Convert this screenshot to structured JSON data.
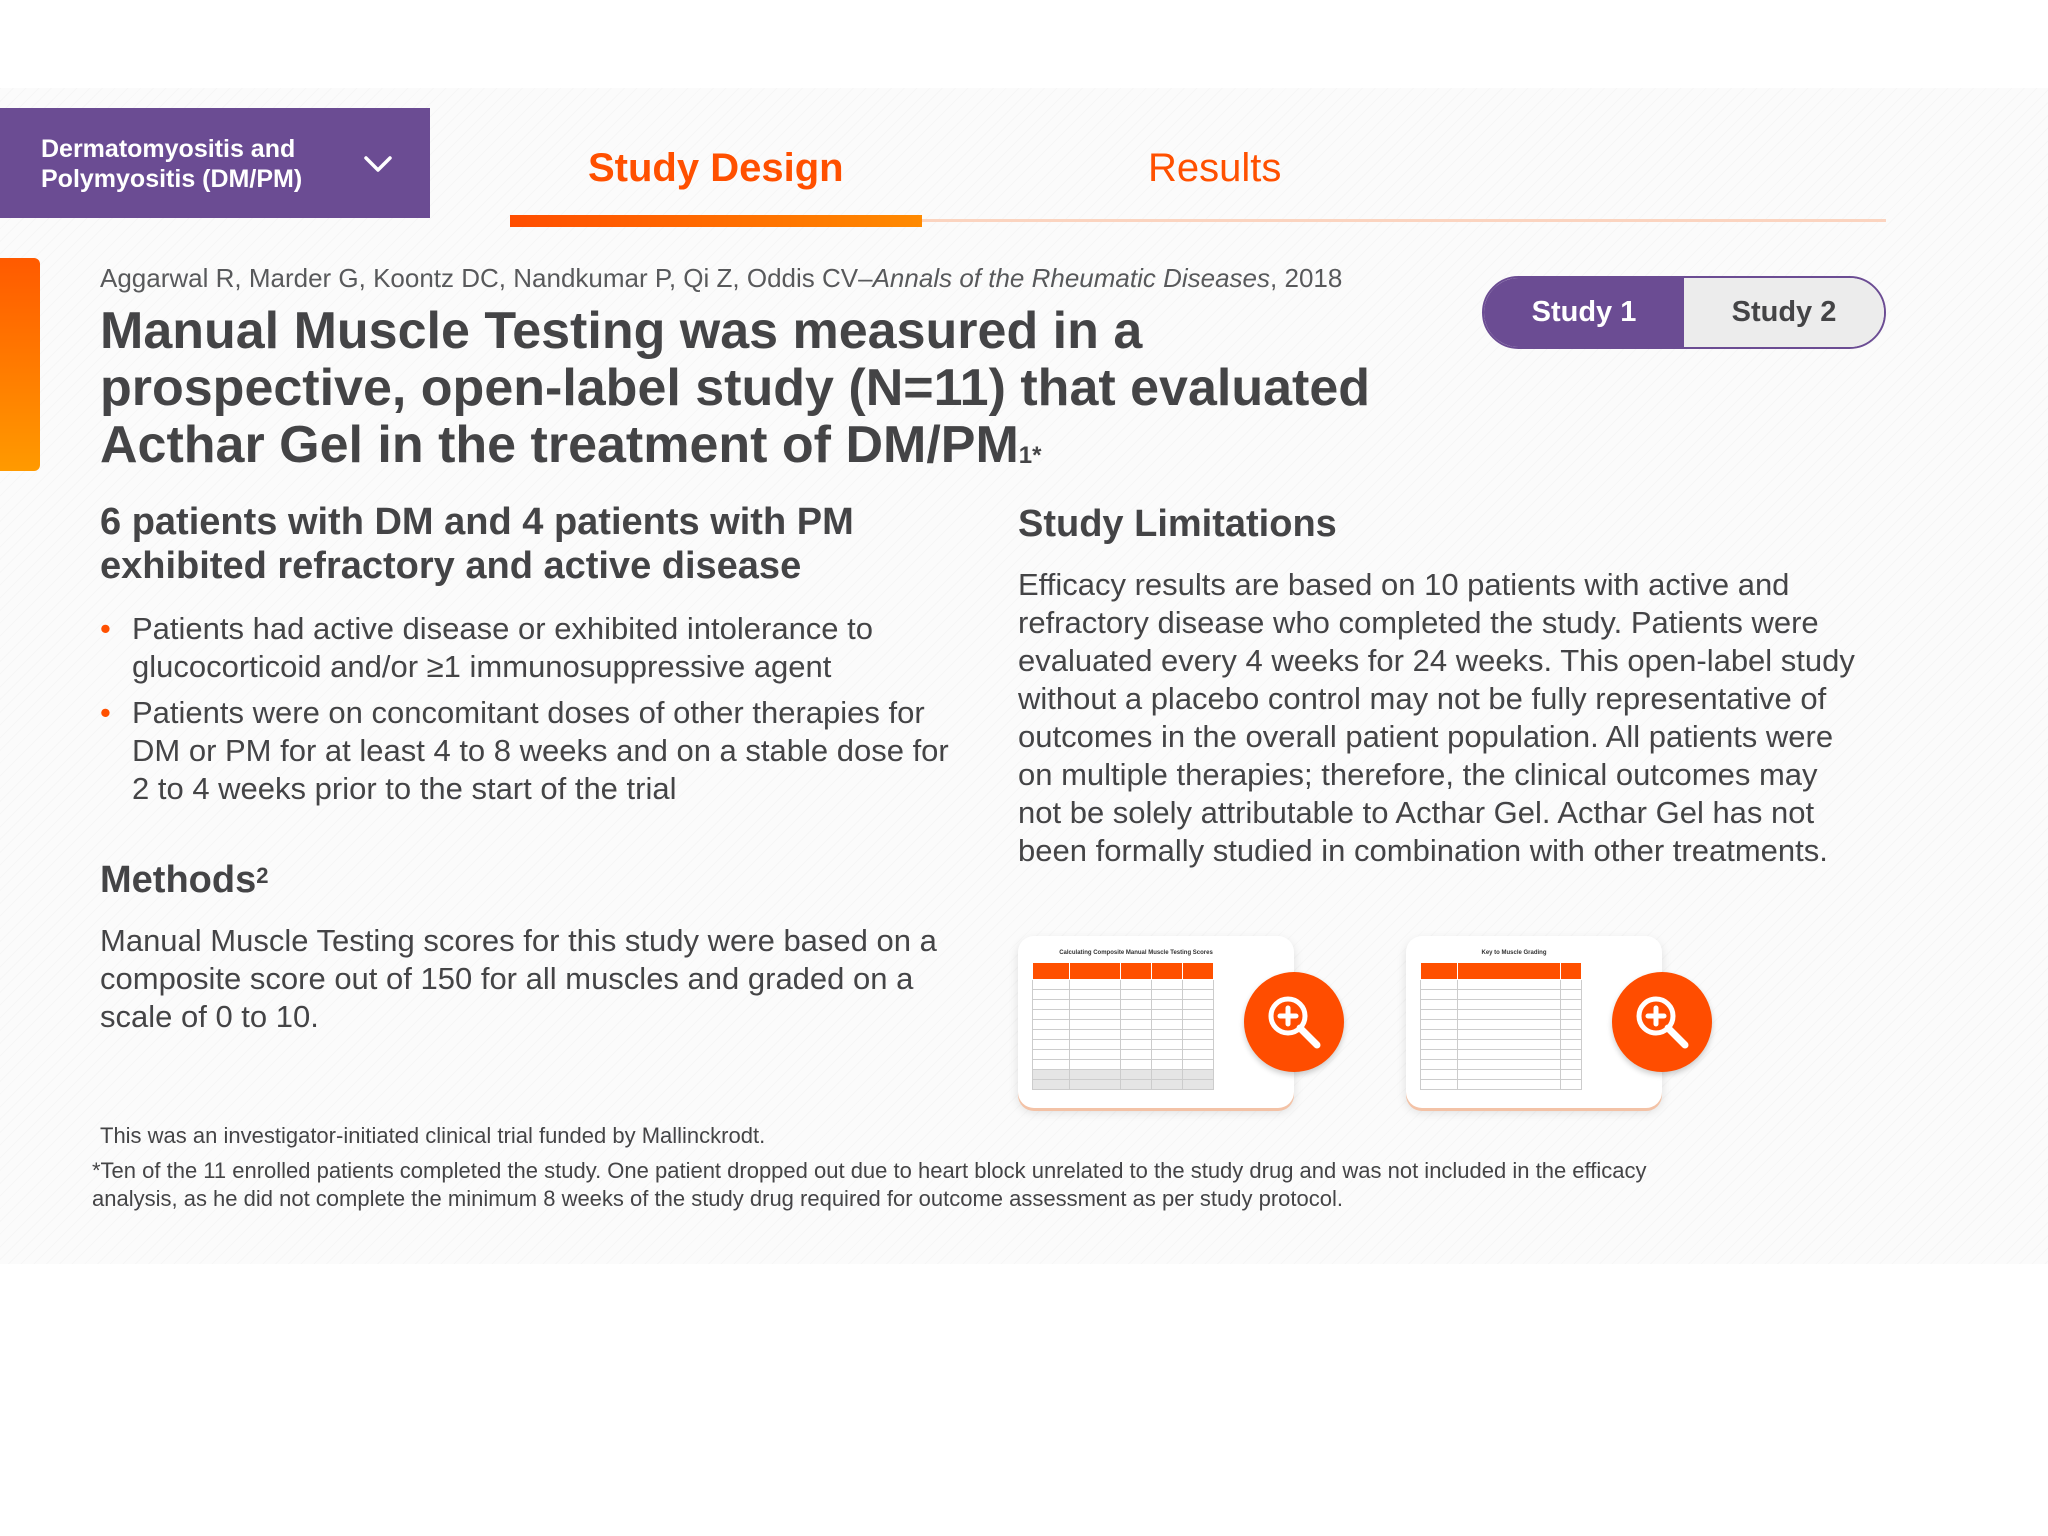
{
  "nav": {
    "dropdown_label": "Dermatomyositis and Polymyositis (DM/PM)",
    "tabs": [
      {
        "label": "Study Design",
        "active": true
      },
      {
        "label": "Results",
        "active": false
      }
    ]
  },
  "study_toggle": [
    {
      "label": "Study 1",
      "active": true
    },
    {
      "label": "Study 2",
      "active": false
    }
  ],
  "citation": {
    "authors": "Aggarwal R, Marder G, Koontz DC, Nandkumar P, Qi Z, Oddis CV–",
    "journal": "Annals of the Rheumatic Diseases",
    "year": ", 2018"
  },
  "headline": {
    "text": "Manual Muscle Testing was measured in a prospective, open-label study (N=11) that evaluated Acthar Gel in the treatment of DM/PM",
    "sup": "1*"
  },
  "patients": {
    "heading": "6 patients with DM and 4 patients with PM exhibited refractory and active disease",
    "bullet_marker": "•",
    "bullets": [
      "Patients had active disease or exhibited intolerance to glucocorticoid and/or ≥1 immunosuppressive agent",
      "Patients were on concomitant doses of other therapies for DM or PM for at least 4 to 8 weeks and on a stable dose for 2 to 4 weeks prior to the start of the trial"
    ]
  },
  "methods": {
    "heading": "Methods",
    "sup": "2",
    "body": "Manual Muscle Testing scores for this study were based on a composite score out of 150 for all muscles and graded on a scale of 0 to 10."
  },
  "limitations": {
    "heading": "Study Limitations",
    "body": "Efficacy results are based on 10 patients with active and refractory disease who completed the study. Patients were evaluated every 4 weeks for 24 weeks. This open-label study without a placebo control may not be fully representative of outcomes in the overall patient population. All patients were on multiple therapies; therefore, the clinical outcomes may not be solely attributable to Acthar Gel. Acthar Gel has not been formally studied in combination with other treatments."
  },
  "thumbnails": [
    {
      "title": "Calculating Composite Manual Muscle Testing Scores",
      "zoom_icon": "zoom-in-icon"
    },
    {
      "title": "Key to Muscle Grading",
      "zoom_icon": "zoom-in-icon"
    }
  ],
  "footnotes": {
    "funding": "This was an investigator-initiated clinical trial funded by Mallinckrodt.",
    "asterisk": "*Ten of the 11 enrolled patients completed the study. One patient dropped out due to heart block unrelated to the study drug and was not included in the efficacy analysis, as he did not complete the minimum 8 weeks of the study drug required for outcome assessment as per study protocol."
  },
  "colors": {
    "brand_purple": "#6b4c93",
    "accent_orange": "#ff5000",
    "text_gray": "#444446"
  }
}
